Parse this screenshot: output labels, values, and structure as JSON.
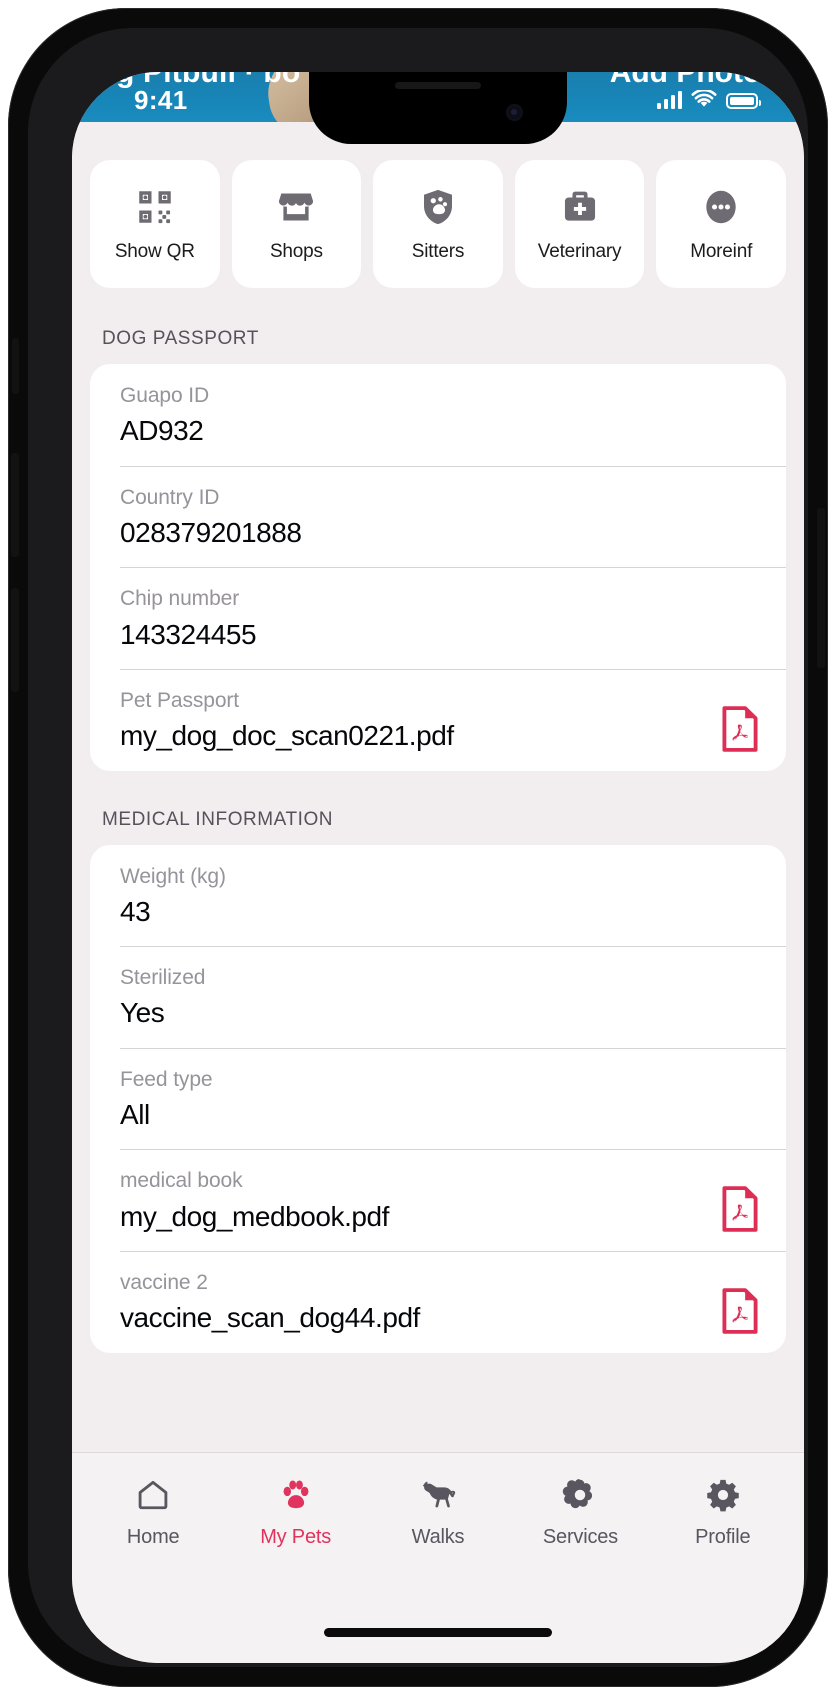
{
  "statusbar": {
    "time": "9:41",
    "signal_icon": "cellular-signal-icon",
    "wifi_icon": "wifi-icon",
    "battery_icon": "battery-full-icon"
  },
  "hero": {
    "title": "g Pitbull · bo",
    "action_label": "Add Photos"
  },
  "quick_actions": [
    {
      "label": "Show QR",
      "icon": "qr-code-icon"
    },
    {
      "label": "Shops",
      "icon": "storefront-icon"
    },
    {
      "label": "Sitters",
      "icon": "shield-paw-icon"
    },
    {
      "label": "Veterinary",
      "icon": "medical-bag-icon"
    },
    {
      "label": "Moreinf",
      "icon": "ellipsis-circle-icon"
    }
  ],
  "sections": [
    {
      "title": "DOG PASSPORT",
      "fields": [
        {
          "label": "Guapo ID",
          "value": "AD932",
          "icon": null
        },
        {
          "label": "Country ID",
          "value": "028379201888",
          "icon": null
        },
        {
          "label": "Chip number",
          "value": "143324455",
          "icon": null
        },
        {
          "label": "Pet Passport",
          "value": "my_dog_doc_scan0221.pdf",
          "icon": "pdf-file-icon"
        }
      ]
    },
    {
      "title": "MEDICAL INFORMATION",
      "fields": [
        {
          "label": "Weight (kg)",
          "value": "43",
          "icon": null
        },
        {
          "label": "Sterilized",
          "value": "Yes",
          "icon": null
        },
        {
          "label": "Feed type",
          "value": "All",
          "icon": null
        },
        {
          "label": "medical book",
          "value": "my_dog_medbook.pdf",
          "icon": "pdf-file-icon"
        },
        {
          "label": "vaccine 2",
          "value": "vaccine_scan_dog44.pdf",
          "icon": "pdf-file-icon"
        }
      ]
    }
  ],
  "tabbar": {
    "items": [
      {
        "label": "Home",
        "icon": "home-icon",
        "active": false
      },
      {
        "label": "My Pets",
        "icon": "paw-icon",
        "active": true
      },
      {
        "label": "Walks",
        "icon": "dog-leash-icon",
        "active": false
      },
      {
        "label": "Services",
        "icon": "cog-icon",
        "active": false
      },
      {
        "label": "Profile",
        "icon": "gear-icon",
        "active": false
      }
    ]
  },
  "colors": {
    "accent": "#e0335e",
    "pdf_red": "#dd2e55",
    "icon_gray": "#6e6b72",
    "page_bg": "#f2eef0",
    "card_bg": "#ffffff",
    "hero_blue": "#1a86b6"
  }
}
